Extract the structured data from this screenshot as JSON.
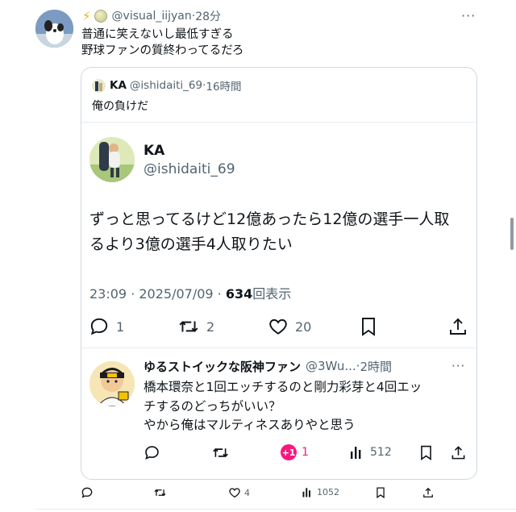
{
  "outer_tweet": {
    "handle": "@visual_iijyan",
    "time": "28分",
    "text_lines": [
      "普通に笑えないし最低すぎる",
      "野球ファンの質終わってるだろ"
    ],
    "actions": {
      "reply_count": "",
      "repost_count": "",
      "like_count": "4",
      "view_count": "1052"
    }
  },
  "quote": {
    "name": "KA",
    "handle": "@ishidaiti_69",
    "time": "16時間",
    "text": "俺の負けだ"
  },
  "main_tweet": {
    "name": "KA",
    "handle": "@ishidaiti_69",
    "body_lines": [
      "ずっと思ってるけど12億あったら12億の選手一人取",
      "るより3億の選手4人取りたい"
    ],
    "timestamp": "23:09 · 2025/07/09 · ",
    "views_number": "634",
    "views_label": "回表示",
    "reply_count": "1",
    "repost_count": "2",
    "like_count": "20"
  },
  "reply": {
    "name": "ゆるストイックな阪神ファン",
    "handle": "@3Wu...",
    "time": "2時間",
    "text_lines": [
      "橋本環奈と1回エッチするのと剛力彩芽と4回エッ",
      "チするのどっちがいい？",
      "やから俺はマルティネスありやと思う"
    ],
    "like_badge": "+1",
    "like_count": "1",
    "view_count": "512"
  },
  "icons": [
    "bolt-icon",
    "baseball-icon",
    "more-icon",
    "reply-icon",
    "repost-icon",
    "like-icon",
    "bookmark-icon",
    "share-icon",
    "views-icon"
  ],
  "colors": {
    "accent_like": "#f91880",
    "muted": "#536471",
    "border": "#cfd9de"
  }
}
